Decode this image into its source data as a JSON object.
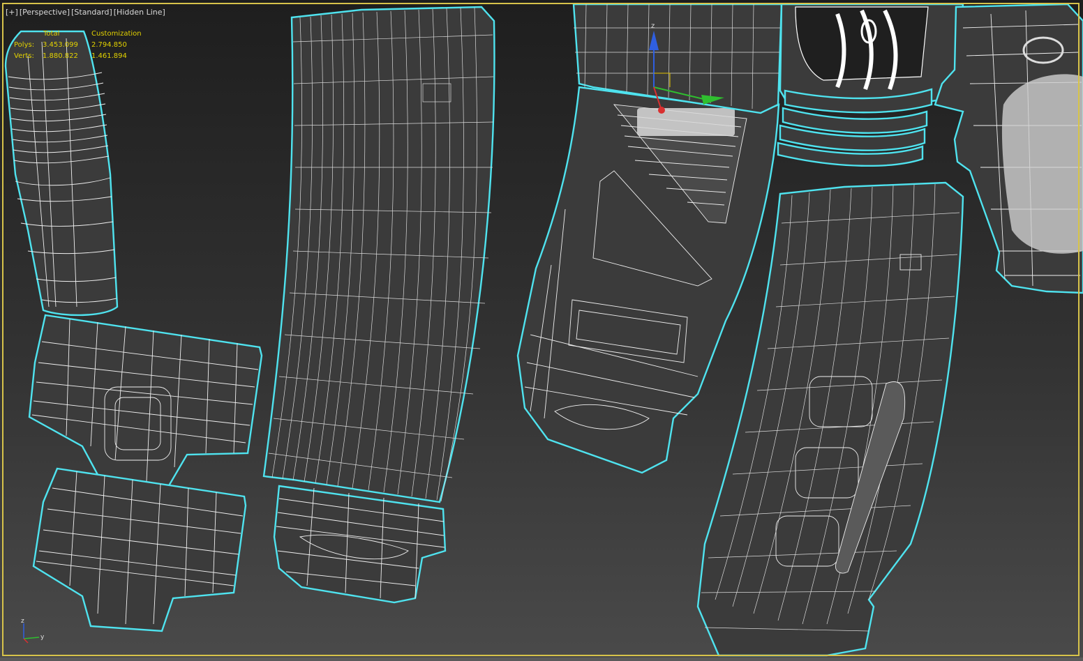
{
  "viewport": {
    "labels": [
      "[+]",
      "[Perspective]",
      "[Standard]",
      "[Hidden Line]"
    ],
    "active_border_color": "#d7c34a",
    "selection_color": "#4fe3ef"
  },
  "stats": {
    "col_total": "Total",
    "col_custom": "Customization",
    "rows": [
      {
        "label": "Polys:",
        "total": "3.453.099",
        "custom": "2.794.850"
      },
      {
        "label": "Verts:",
        "total": "1.880.822",
        "custom": "1.461.894"
      }
    ],
    "color": "#e3d200"
  },
  "gizmo": {
    "z_label": "z",
    "axis_colors": {
      "x": "#d93030",
      "y": "#2fbf2f",
      "z": "#2f5fe0"
    }
  },
  "tripod": {
    "z_label": "z",
    "y_label": "y"
  }
}
